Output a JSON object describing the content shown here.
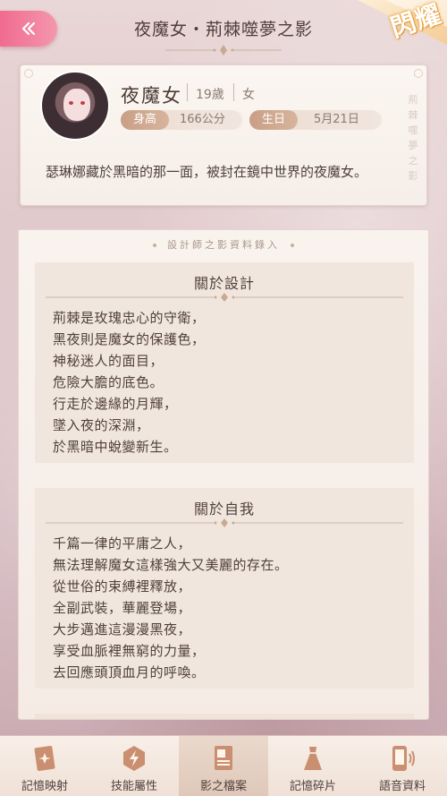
{
  "header": {
    "title": "夜魔女・荊棘噬夢之影",
    "back_icon": "double-chevron-left-icon",
    "badge": "閃耀"
  },
  "profile": {
    "name": "夜魔女",
    "age": "19歲",
    "gender": "女",
    "height_label": "身高",
    "height_value": "166公分",
    "birthday_label": "生日",
    "birthday_value": "5月21日",
    "vertical_text": "荊棘噬夢之影",
    "description": "瑟琳娜藏於黑暗的那一面，被封在鏡中世界的夜魔女。"
  },
  "info": {
    "subtitle": "設計師之影資料錄入",
    "sections": [
      {
        "title": "關於設計",
        "lines": [
          "荊棘是玫瑰忠心的守衛，",
          "黑夜則是魔女的保護色，",
          "神秘迷人的面目，",
          "危險大膽的底色。",
          "行走於邊緣的月輝，",
          "墜入夜的深淵，",
          "於黑暗中蛻變新生。"
        ]
      },
      {
        "title": "關於自我",
        "lines": [
          "千篇一律的平庸之人，",
          "無法理解魔女這樣強大又美麗的存在。",
          "從世俗的束縛裡釋放，",
          "全副武裝，華麗登場，",
          "大步邁進這漫漫黑夜，",
          "享受血脈裡無窮的力量，",
          "去回應頭頂血月的呼喚。"
        ]
      }
    ]
  },
  "nav": {
    "items": [
      {
        "label": "記憶映射",
        "icon": "memory-card-icon",
        "active": false
      },
      {
        "label": "技能屬性",
        "icon": "lightning-hexagon-icon",
        "active": false
      },
      {
        "label": "影之檔案",
        "icon": "document-profile-icon",
        "active": true
      },
      {
        "label": "記憶碎片",
        "icon": "dress-icon",
        "active": false
      },
      {
        "label": "語音資料",
        "icon": "phone-voice-icon",
        "active": false
      }
    ]
  },
  "colors": {
    "accent_pink": "#f06b8f",
    "pill_brown": "#c99f86",
    "text_dark": "#4f3f3a",
    "card_bg": "#f9f3ee"
  }
}
